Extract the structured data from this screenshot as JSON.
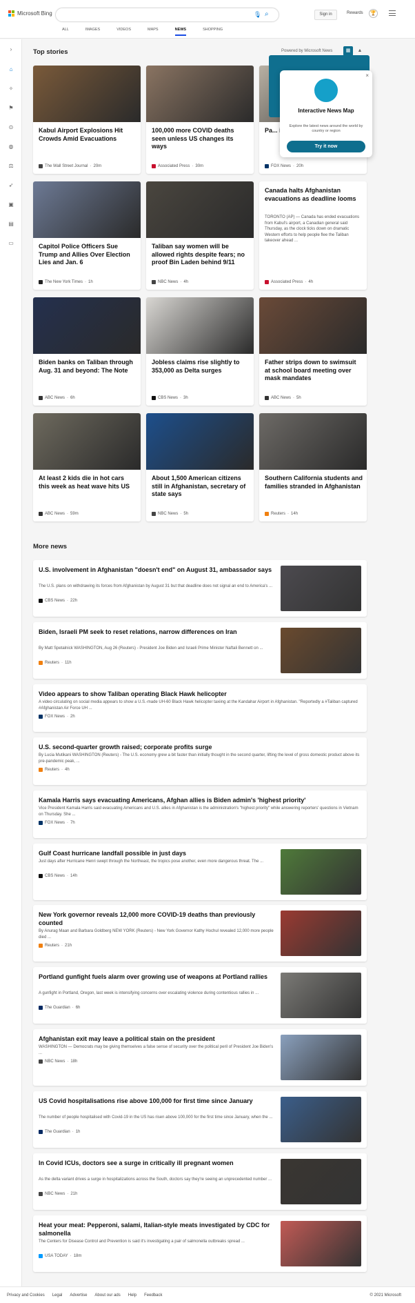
{
  "brand": {
    "name": "Microsoft Bing"
  },
  "header": {
    "search_placeholder": "",
    "signin_label": "Sign in",
    "rewards_label": "Rewards",
    "tabs": [
      {
        "label": "ALL",
        "active": false
      },
      {
        "label": "IMAGES",
        "active": false
      },
      {
        "label": "VIDEOS",
        "active": false
      },
      {
        "label": "MAPS",
        "active": false
      },
      {
        "label": "NEWS",
        "active": true
      },
      {
        "label": "SHOPPING",
        "active": false
      }
    ]
  },
  "sidebar": {
    "icons": [
      "chevron-right-icon",
      "home-icon",
      "sparkle-icon",
      "flag-icon",
      "location-icon",
      "globe-icon",
      "scales-icon",
      "rocket-icon",
      "film-icon",
      "bank-icon",
      "credit-card-icon"
    ]
  },
  "top_stories": {
    "heading": "Top stories",
    "powered_by": "Powered by Microsoft News",
    "cards": [
      {
        "title": "Kabul Airport Explosions Hit Crowds Amid Evacuations",
        "source": "The Wall Street Journal",
        "time": "20m",
        "color": "#7a5a3a"
      },
      {
        "title": "100,000 more COVID deaths seen unless US changes its ways",
        "source": "Associated Press",
        "time": "30m",
        "color": "#8a7462"
      },
      {
        "title": "Pa... in ... qu...",
        "source": "FOX News",
        "time": "20h",
        "color": "#b9b1a4"
      },
      {
        "title": "Capitol Police Officers Sue Trump and Allies Over Election Lies and Jan. 6",
        "source": "The New York Times",
        "time": "1h",
        "color": "#6d7a95"
      },
      {
        "title": "Taliban say women will be allowed rights despite fears; no proof Bin Laden behind 9/11",
        "source": "NBC News",
        "time": "4h",
        "color": "#4a463f"
      },
      {
        "title": "Canada halts Afghanistan evacuations as deadline looms",
        "snippet": "TORONTO (AP) — Canada has ended evacuations from Kabul's airport, a Canadian general said Thursday, as the clock ticks down on dramatic Western efforts to help people flee the Taliban takeover ahead ...",
        "source": "Associated Press",
        "time": "4h"
      },
      {
        "title": "Biden banks on Taliban through Aug. 31 and beyond: The Note",
        "source": "ABC News",
        "time": "6h",
        "color": "#24304e"
      },
      {
        "title": "Jobless claims rise slightly to 353,000 as Delta surges",
        "source": "CBS News",
        "time": "3h",
        "color": "#d9d7d3"
      },
      {
        "title": "Father strips down to swimsuit at school board meeting over mask mandates",
        "source": "ABC News",
        "time": "5h",
        "color": "#6a4a38"
      },
      {
        "title": "At least 2 kids die in hot cars this week as heat wave hits US",
        "source": "ABC News",
        "time": "59m",
        "color": "#6e6a5e"
      },
      {
        "title": "About 1,500 American citizens still in Afghanistan, secretary of state says",
        "source": "NBC News",
        "time": "5h",
        "color": "#1d4f8c"
      },
      {
        "title": "Southern California students and families stranded in Afghanistan",
        "source": "Reuters",
        "time": "14h",
        "color": "#6d6a66"
      }
    ]
  },
  "popup": {
    "title": "Interactive News Map",
    "subtitle": "Explore the latest news around the world by country or region",
    "button": "Try it now",
    "close": "×"
  },
  "more_news": {
    "heading": "More news",
    "items": [
      {
        "title": "U.S. involvement in Afghanistan \"doesn't end\" on August 31, ambassador says",
        "snippet": "The U.S. plans on withdrawing its forces from Afghanistan by August 31 but that deadline does not signal an end to America's ...",
        "source": "CBS News",
        "time": "22h",
        "thumb": "#4c4a4f"
      },
      {
        "title": "Biden, Israeli PM seek to reset relations, narrow differences on Iran",
        "snippet": "By Matt Spetalnick WASHINGTON, Aug 26 (Reuters) - President Joe Biden and Israeli Prime Minister Naftali Bennett on ...",
        "source": "Reuters",
        "time": "11h",
        "thumb": "#6a4a2e"
      },
      {
        "title": "Video appears to show Taliban operating Black Hawk helicopter",
        "snippet": "A video circulating on social media appears to show a U.S.-made UH-60 Black Hawk helicopter taxiing at the Kandahar Airport in Afghanistan. \"Reportedly a #Taliban captured #Afghanistan Air Force UH ...",
        "source": "FOX News",
        "time": "2h"
      },
      {
        "title": "U.S. second-quarter growth raised; corporate profits surge",
        "snippet": "By Lucia Mutikani WASHINGTON (Reuters) - The U.S. economy grew a bit faster than initially thought in the second quarter, lifting the level of gross domestic product above its pre-pandemic peak, ...",
        "source": "Reuters",
        "time": "4h"
      },
      {
        "title": "Kamala Harris says evacuating Americans, Afghan allies is Biden admin's 'highest priority'",
        "snippet": "Vice President Kamala Harris said evacuating Americans and U.S. allies in Afghanistan is the administration's \"highest priority\" while answering reporters' questions in Vietnam on Thursday.  She ...",
        "source": "FOX News",
        "time": "7h"
      },
      {
        "title": "Gulf Coast hurricane landfall possible in just days",
        "snippet": "Just days after Hurricane Henri swept through the Northeast, the tropics pose another, even more dangerous threat. The ...",
        "source": "CBS News",
        "time": "14h",
        "thumb": "#4f7a3a"
      },
      {
        "title": "New York governor reveals 12,000 more COVID-19 deaths than previously counted",
        "snippet": "By Anurag Maan and Barbara Goldberg NEW YORK (Reuters) - New York Governor Kathy Hochul revealed 12,000 more people died ...",
        "source": "Reuters",
        "time": "21h",
        "thumb": "#9a3a32"
      },
      {
        "title": "Portland gunfight fuels alarm over growing use of weapons at Portland rallies",
        "snippet": "A gunfight in Portland, Oregon, last week is intensifying concerns over escalating violence during contentious rallies in ...",
        "source": "The Guardian",
        "time": "6h",
        "thumb": "#7b7a76"
      },
      {
        "title": "Afghanistan exit may leave a political stain on the president",
        "snippet": "WASHINGTON — Democrats may be giving themselves a false sense of security over the political peril of President Joe Biden's ...",
        "source": "NBC News",
        "time": "18h",
        "thumb": "#8aa0bd"
      },
      {
        "title": "US Covid hospitalisations rise above 100,000 for first time since January",
        "snippet": "The number of people hospitalised with Covid-19 in the US has risen above 100,000 for the first time since January, when the ...",
        "source": "The Guardian",
        "time": "1h",
        "thumb": "#3b5e8a"
      },
      {
        "title": "In Covid ICUs, doctors see a surge in critically ill pregnant women",
        "snippet": "As the delta variant drives a surge in hospitalizations across the South, doctors say they're seeing an unprecedented number ...",
        "source": "NBC News",
        "time": "21h",
        "thumb": "#3a3632"
      },
      {
        "title": "Heat your meat: Pepperoni, salami, Italian-style meats investigated by CDC for salmonella",
        "snippet": "The Centers for Disease Control and Prevention is said it's investigating a pair of salmonella outbreaks spread ...",
        "source": "USA TODAY",
        "time": "18m",
        "thumb": "#c15a55"
      }
    ]
  },
  "footer": {
    "links": [
      "Privacy and Cookies",
      "Legal",
      "Advertise",
      "About our ads",
      "Help",
      "Feedback"
    ],
    "copyright": "© 2021 Microsoft"
  }
}
